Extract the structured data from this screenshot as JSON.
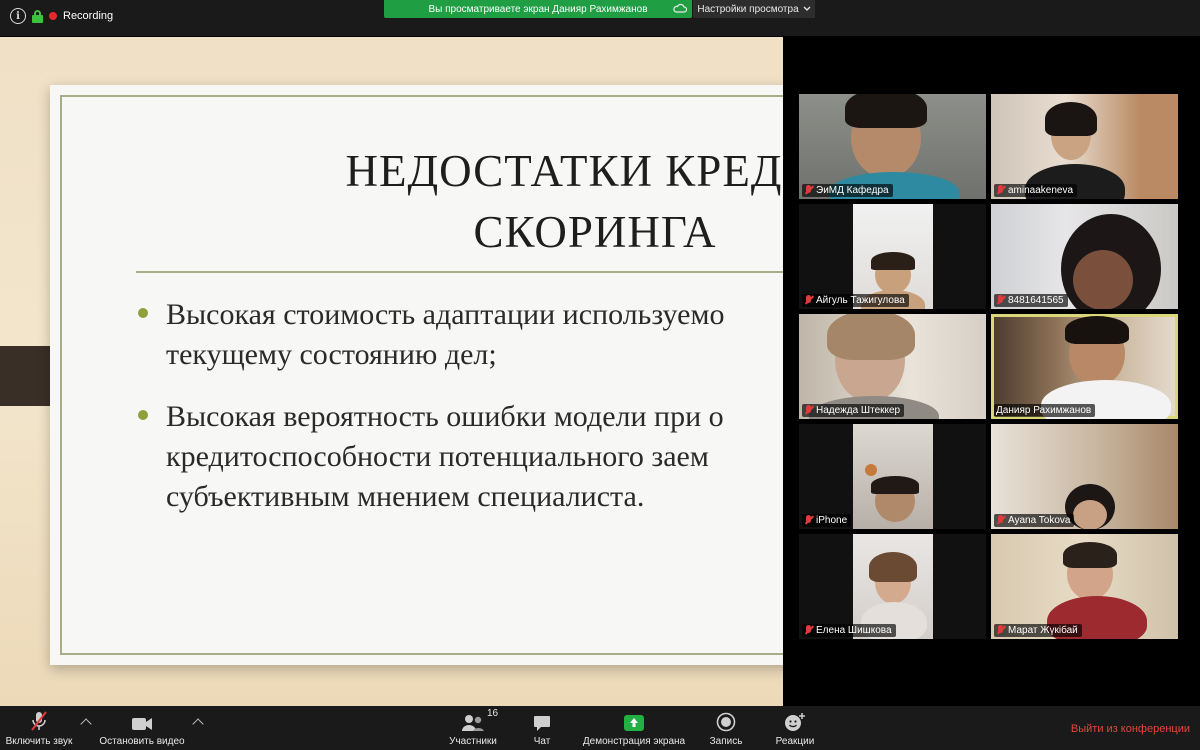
{
  "topbar": {
    "recording_label": "Recording",
    "share_banner": "Вы просматриваете экран Данияр Рахимжанов",
    "view_settings": "Настройки просмотра"
  },
  "slide": {
    "title_line1": "НЕДОСТАТКИ КРЕДИТ",
    "title_line2": "СКОРИНГА",
    "bullets": [
      "Высокая стоимость адаптации используемо\nтекущему состоянию дел;",
      "Высокая вероятность ошибки модели при о\nкредитоспособности потенциального заем\nсубъективным мнением специалиста."
    ]
  },
  "participants": [
    {
      "name": "ЭиМД Кафедра"
    },
    {
      "name": "aminaakeneva"
    },
    {
      "name": "Айгуль Тажигулова"
    },
    {
      "name": "8481641565"
    },
    {
      "name": "Надежда Штеккер"
    },
    {
      "name": "Данияр Рахимжанов"
    },
    {
      "name": "iPhone"
    },
    {
      "name": "Ayana Tokova"
    },
    {
      "name": "Елена Шишкова"
    },
    {
      "name": "Марат Жүкібай"
    }
  ],
  "toolbar": {
    "mute_label": "Включить звук",
    "video_label": "Остановить видео",
    "participants_label": "Участники",
    "participants_count": "16",
    "chat_label": "Чат",
    "share_label": "Демонстрация экрана",
    "record_label": "Запись",
    "reactions_label": "Реакции",
    "leave_label": "Выйти из конференции"
  },
  "colors": {
    "share_banner_bg": "#1f9e43",
    "muted_red": "#e23b3b",
    "leave_red": "#e8443c",
    "slide_accent": "#8ea03c"
  }
}
